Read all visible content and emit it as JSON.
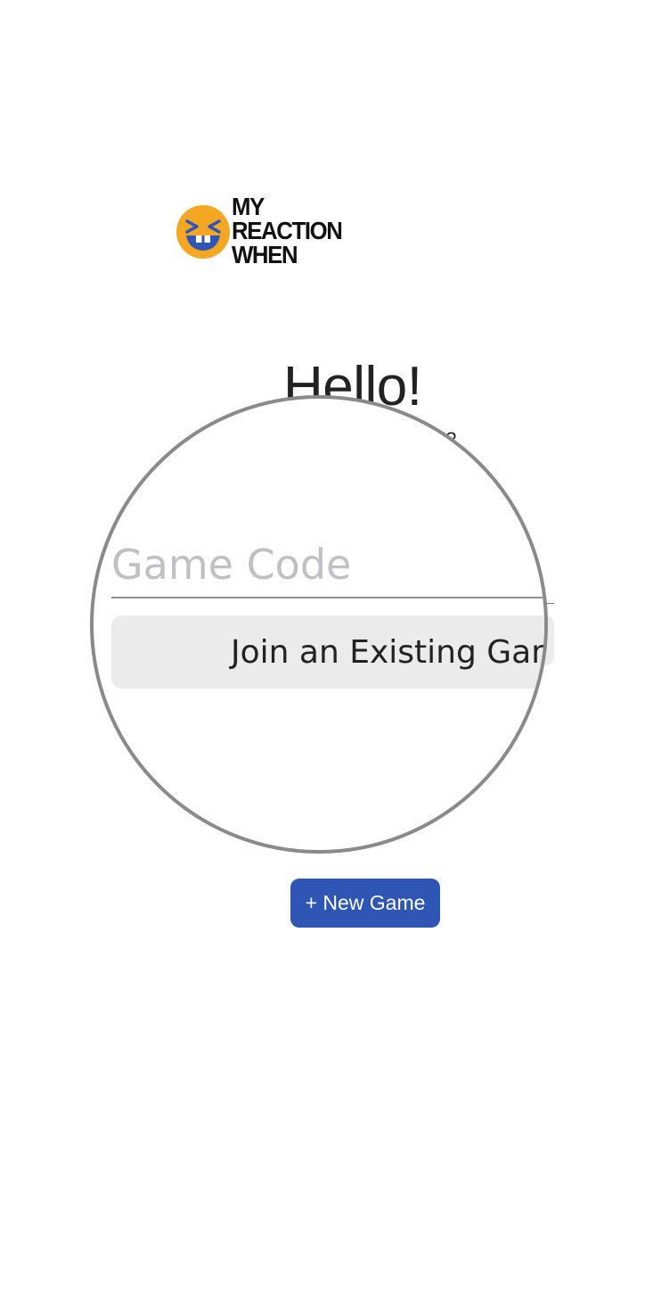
{
  "logo": {
    "line1": "MY",
    "line2": "REACTION",
    "line3": "WHEN",
    "icon": "laughing-face-icon",
    "face_color": "#F5A623",
    "accent_color": "#2F55B5"
  },
  "greeting": {
    "title": "Hello!",
    "subtitle_partial": "ct?"
  },
  "join": {
    "placeholder": "Game Code",
    "value": "",
    "button_label": "Join an Existing Game"
  },
  "new_game": {
    "button_label": "+ New Game",
    "color": "#2F55B5"
  }
}
